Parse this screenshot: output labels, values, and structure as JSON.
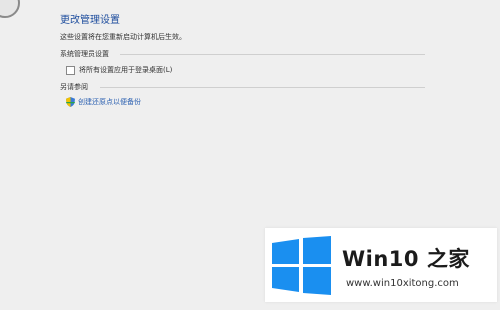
{
  "window": {
    "title": "更改管理设置",
    "subtitle": "这些设置将在您重新启动计算机后生效。"
  },
  "admin_settings": {
    "header": "系统管理员设置",
    "apply_all_checkbox": {
      "label": "将所有设置应用于登录桌面(L)",
      "checked": false
    }
  },
  "see_also": {
    "header": "另请参阅",
    "restore_point_link": "创建还原点以便备份"
  },
  "watermark": {
    "brand_prefix": "Win10 ",
    "brand_suffix": "之家",
    "url": "www.win10xitong.com",
    "logo_color": "#1a8ff0"
  }
}
